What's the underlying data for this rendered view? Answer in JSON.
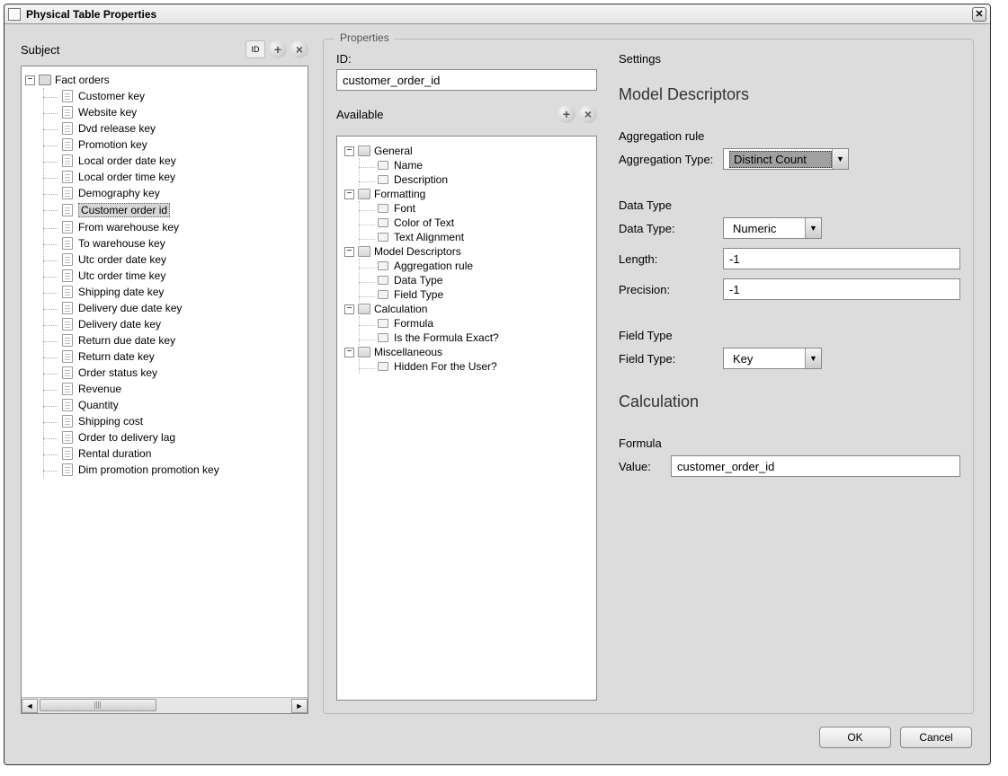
{
  "windowTitle": "Physical Table Properties",
  "subject": {
    "label": "Subject",
    "rootLabel": "Fact orders",
    "items": [
      "Customer key",
      "Website key",
      "Dvd release key",
      "Promotion key",
      "Local order date key",
      "Local order time key",
      "Demography key",
      "Customer order id",
      "From warehouse key",
      "To warehouse key",
      "Utc order date key",
      "Utc order time key",
      "Shipping date key",
      "Delivery due date key",
      "Delivery date key",
      "Return due date key",
      "Return date key",
      "Order status key",
      "Revenue",
      "Quantity",
      "Shipping cost",
      "Order to delivery lag",
      "Rental duration",
      "Dim promotion promotion key"
    ],
    "selectedIndex": 7
  },
  "properties": {
    "legend": "Properties",
    "idLabel": "ID:",
    "idValue": "customer_order_id",
    "availableLabel": "Available",
    "availableGroups": [
      {
        "name": "General",
        "children": [
          "Name",
          "Description"
        ]
      },
      {
        "name": "Formatting",
        "children": [
          "Font",
          "Color of Text",
          "Text Alignment"
        ]
      },
      {
        "name": "Model Descriptors",
        "children": [
          "Aggregation rule",
          "Data Type",
          "Field Type"
        ]
      },
      {
        "name": "Calculation",
        "children": [
          "Formula",
          "Is the Formula Exact?"
        ]
      },
      {
        "name": "Miscellaneous",
        "children": [
          "Hidden For the User?"
        ]
      }
    ]
  },
  "settings": {
    "label": "Settings",
    "modelDescriptorsHeading": "Model Descriptors",
    "aggRule": {
      "heading": "Aggregation rule",
      "typeLabel": "Aggregation Type:",
      "typeValue": "Distinct Count"
    },
    "dataType": {
      "heading": "Data Type",
      "label": "Data Type:",
      "value": "Numeric",
      "lengthLabel": "Length:",
      "lengthValue": "-1",
      "precisionLabel": "Precision:",
      "precisionValue": "-1"
    },
    "fieldType": {
      "heading": "Field Type",
      "label": "Field Type:",
      "value": "Key"
    },
    "calculationHeading": "Calculation",
    "formula": {
      "heading": "Formula",
      "valueLabel": "Value:",
      "value": "customer_order_id"
    }
  },
  "buttons": {
    "ok": "OK",
    "cancel": "Cancel"
  }
}
